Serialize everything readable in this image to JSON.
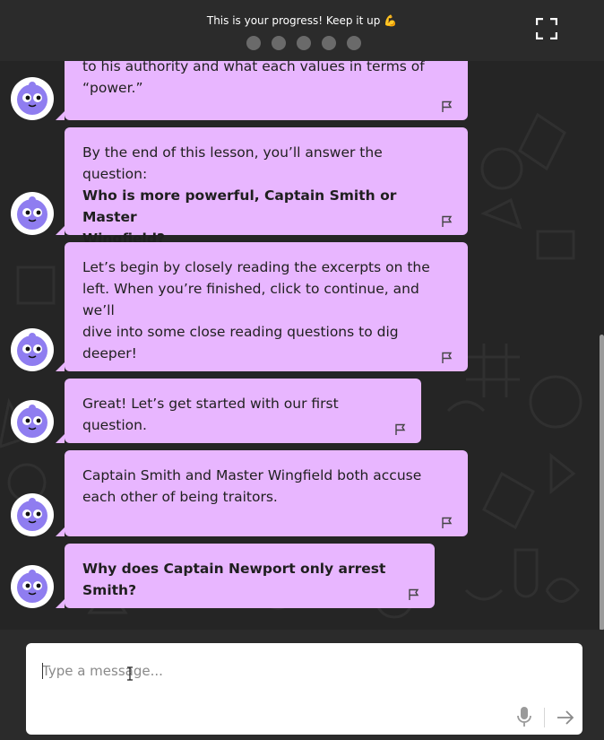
{
  "header": {
    "progress_text": "This is your progress! Keep it up 💪",
    "progress_dots": 5,
    "expand_icon": "fullscreen-icon"
  },
  "colors": {
    "bubble": "#e8b6ff",
    "background": "#252525",
    "topbar": "#2b2b2b",
    "dot": "#6a6a6a",
    "avatar_body": "#8f7df0"
  },
  "messages": [
    {
      "lines": [
        {
          "text": "to his authority and what each values in terms of",
          "bold": false
        },
        {
          "text": "“power.”",
          "bold": false
        }
      ]
    },
    {
      "lines": [
        {
          "text": "By the end of this lesson, you’ll answer the question:",
          "bold": false
        },
        {
          "text": "Who is more powerful, Captain Smith or Master",
          "bold": true
        },
        {
          "text": "Wingfield?",
          "bold": true
        }
      ]
    },
    {
      "lines": [
        {
          "text": "Let’s begin by closely reading the excerpts on the",
          "bold": false
        },
        {
          "text": "left. When you’re finished, click to continue, and we’ll",
          "bold": false
        },
        {
          "text": "dive into some close reading questions to dig",
          "bold": false
        },
        {
          "text": "deeper!",
          "bold": false
        }
      ]
    },
    {
      "lines": [
        {
          "text": "Great! Let’s get started with our first question.",
          "bold": false
        }
      ]
    },
    {
      "lines": [
        {
          "text": "Captain Smith and Master Wingfield both accuse",
          "bold": false
        },
        {
          "text": "each other of being traitors.",
          "bold": false
        }
      ]
    },
    {
      "lines": [
        {
          "text": "Why does Captain Newport only arrest Smith?",
          "bold": true
        }
      ]
    }
  ],
  "composer": {
    "placeholder": "Type a message...",
    "mic_icon": "microphone-icon",
    "send_icon": "send-arrow-icon"
  }
}
